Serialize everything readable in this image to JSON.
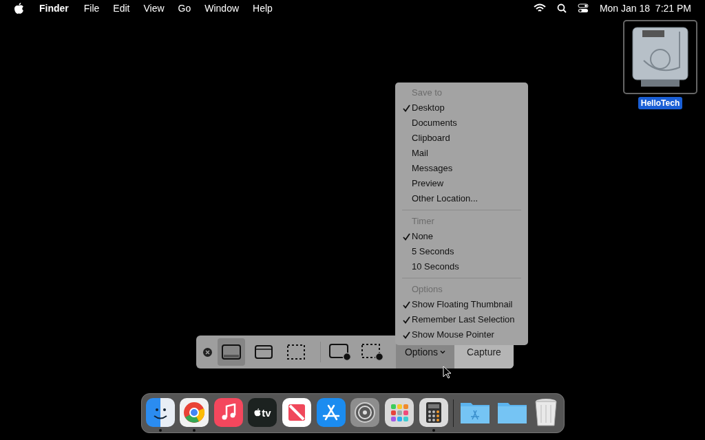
{
  "menu_bar": {
    "app_name": "Finder",
    "menus": [
      "File",
      "Edit",
      "View",
      "Go",
      "Window",
      "Help"
    ],
    "clock": "Mon Jan 18  7:21 PM"
  },
  "desktop_icons": [
    {
      "label": "HelloTech",
      "selected": true
    }
  ],
  "options_menu": {
    "sections": [
      {
        "heading": "Save to",
        "items": [
          {
            "label": "Desktop",
            "checked": true
          },
          {
            "label": "Documents",
            "checked": false
          },
          {
            "label": "Clipboard",
            "checked": false
          },
          {
            "label": "Mail",
            "checked": false
          },
          {
            "label": "Messages",
            "checked": false
          },
          {
            "label": "Preview",
            "checked": false
          },
          {
            "label": "Other Location...",
            "checked": false
          }
        ]
      },
      {
        "heading": "Timer",
        "items": [
          {
            "label": "None",
            "checked": true
          },
          {
            "label": "5 Seconds",
            "checked": false
          },
          {
            "label": "10 Seconds",
            "checked": false
          }
        ]
      },
      {
        "heading": "Options",
        "items": [
          {
            "label": "Show Floating Thumbnail",
            "checked": true
          },
          {
            "label": "Remember Last Selection",
            "checked": true
          },
          {
            "label": "Show Mouse Pointer",
            "checked": true
          }
        ]
      }
    ]
  },
  "capture_toolbar": {
    "modes": [
      {
        "kind": "entire-screen",
        "selected": true
      },
      {
        "kind": "window",
        "selected": false
      },
      {
        "kind": "selection",
        "selected": false
      },
      {
        "kind": "record-screen",
        "selected": false
      },
      {
        "kind": "record-selection",
        "selected": false
      }
    ],
    "options_button": {
      "label": "Options",
      "selected": true
    },
    "capture_button": {
      "label": "Capture"
    }
  },
  "dock": [
    {
      "kind": "finder",
      "running": true
    },
    {
      "kind": "chrome",
      "running": true
    },
    {
      "kind": "music",
      "running": false
    },
    {
      "kind": "tv",
      "text": "tv",
      "running": false
    },
    {
      "kind": "news",
      "running": false
    },
    {
      "kind": "appstore",
      "running": false
    },
    {
      "kind": "settings",
      "running": false
    },
    {
      "kind": "launchpad",
      "running": false
    },
    {
      "kind": "calculator",
      "running": true
    },
    {
      "kind": "separator"
    },
    {
      "kind": "apps-folder",
      "running": false
    },
    {
      "kind": "folder",
      "running": false
    },
    {
      "kind": "trash",
      "running": false
    }
  ]
}
